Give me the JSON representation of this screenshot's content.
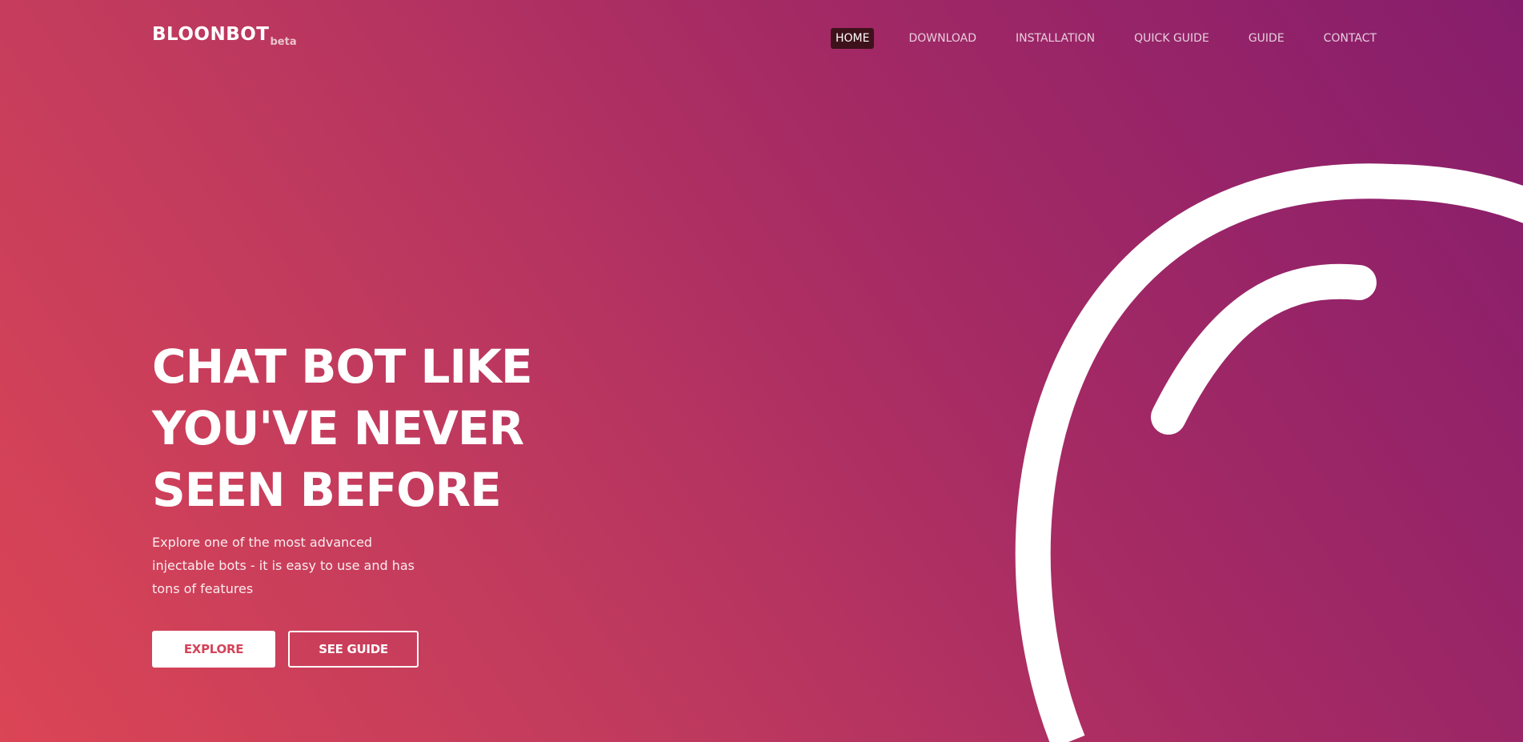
{
  "brand": {
    "name": "BLOONBOT",
    "tag": "beta"
  },
  "nav": {
    "items": [
      {
        "label": "HOME",
        "active": true
      },
      {
        "label": "DOWNLOAD",
        "active": false
      },
      {
        "label": "INSTALLATION",
        "active": false
      },
      {
        "label": "QUICK GUIDE",
        "active": false
      },
      {
        "label": "GUIDE",
        "active": false
      },
      {
        "label": "CONTACT",
        "active": false
      }
    ]
  },
  "hero": {
    "title_lines": [
      "CHAT BOT LIKE",
      "YOU'VE NEVER",
      "SEEN BEFORE"
    ],
    "subtitle": "Explore one of the most advanced injectable bots - it is easy to use and has tons of features"
  },
  "actions": {
    "explore_label": "EXPLORE",
    "guide_label": "SEE GUIDE"
  },
  "colors": {
    "gradient_top_right": "#861d6c",
    "gradient_bottom_left": "#db4555",
    "active_nav_bg": "#3e121b",
    "explore_text": "#d4445a"
  },
  "icons": {
    "decoration": "balloon-arc-icon"
  }
}
